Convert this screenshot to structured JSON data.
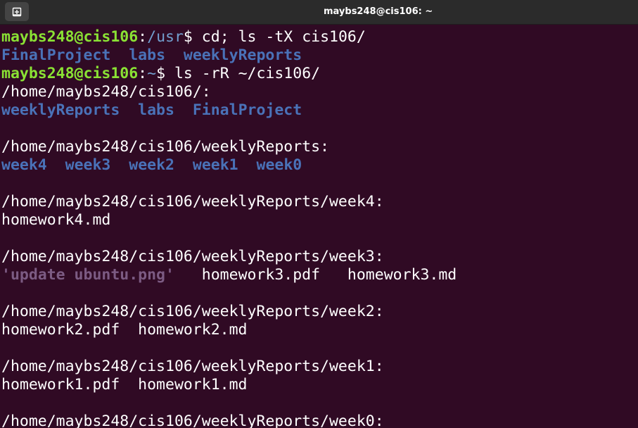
{
  "titlebar": {
    "title": "maybs248@cis106: ~",
    "new_tab_icon": "new-tab-icon"
  },
  "colors": {
    "background": "#300a24",
    "prompt_user": "#8ae234",
    "prompt_path": "#729fcf",
    "directory": "#4a72b8",
    "quoted_file": "#7c5b83",
    "text": "#ffffff"
  },
  "terminal": {
    "cmd1": {
      "user": "maybs248@cis106",
      "colon": ":",
      "path": "/usr",
      "dollar": "$",
      "command": " cd; ls -tX cis106/"
    },
    "out1": {
      "d1": "FinalProject",
      "d2": "labs",
      "d3": "weeklyReports"
    },
    "cmd2": {
      "user": "maybs248@cis106",
      "colon": ":",
      "path": "~",
      "dollar": "$",
      "command": " ls -rR ~/cis106/"
    },
    "h1": "/home/maybs248/cis106/:",
    "out2": {
      "d1": "weeklyReports",
      "d2": "labs",
      "d3": "FinalProject"
    },
    "h2": "/home/maybs248/cis106/weeklyReports:",
    "out3": {
      "d1": "week4",
      "d2": "week3",
      "d3": "week2",
      "d4": "week1",
      "d5": "week0"
    },
    "h3": "/home/maybs248/cis106/weeklyReports/week4:",
    "out4": {
      "f1": "homework4.md"
    },
    "h4": "/home/maybs248/cis106/weeklyReports/week3:",
    "out5": {
      "q1": "'update ubuntu.png'",
      "f1": "homework3.pdf",
      "f2": "homework3.md"
    },
    "h5": "/home/maybs248/cis106/weeklyReports/week2:",
    "out6": {
      "f1": "homework2.pdf",
      "f2": "homework2.md"
    },
    "h6": "/home/maybs248/cis106/weeklyReports/week1:",
    "out7": {
      "f1": "homework1.pdf",
      "f2": "homework1.md"
    },
    "h7": "/home/maybs248/cis106/weeklyReports/week0:"
  }
}
